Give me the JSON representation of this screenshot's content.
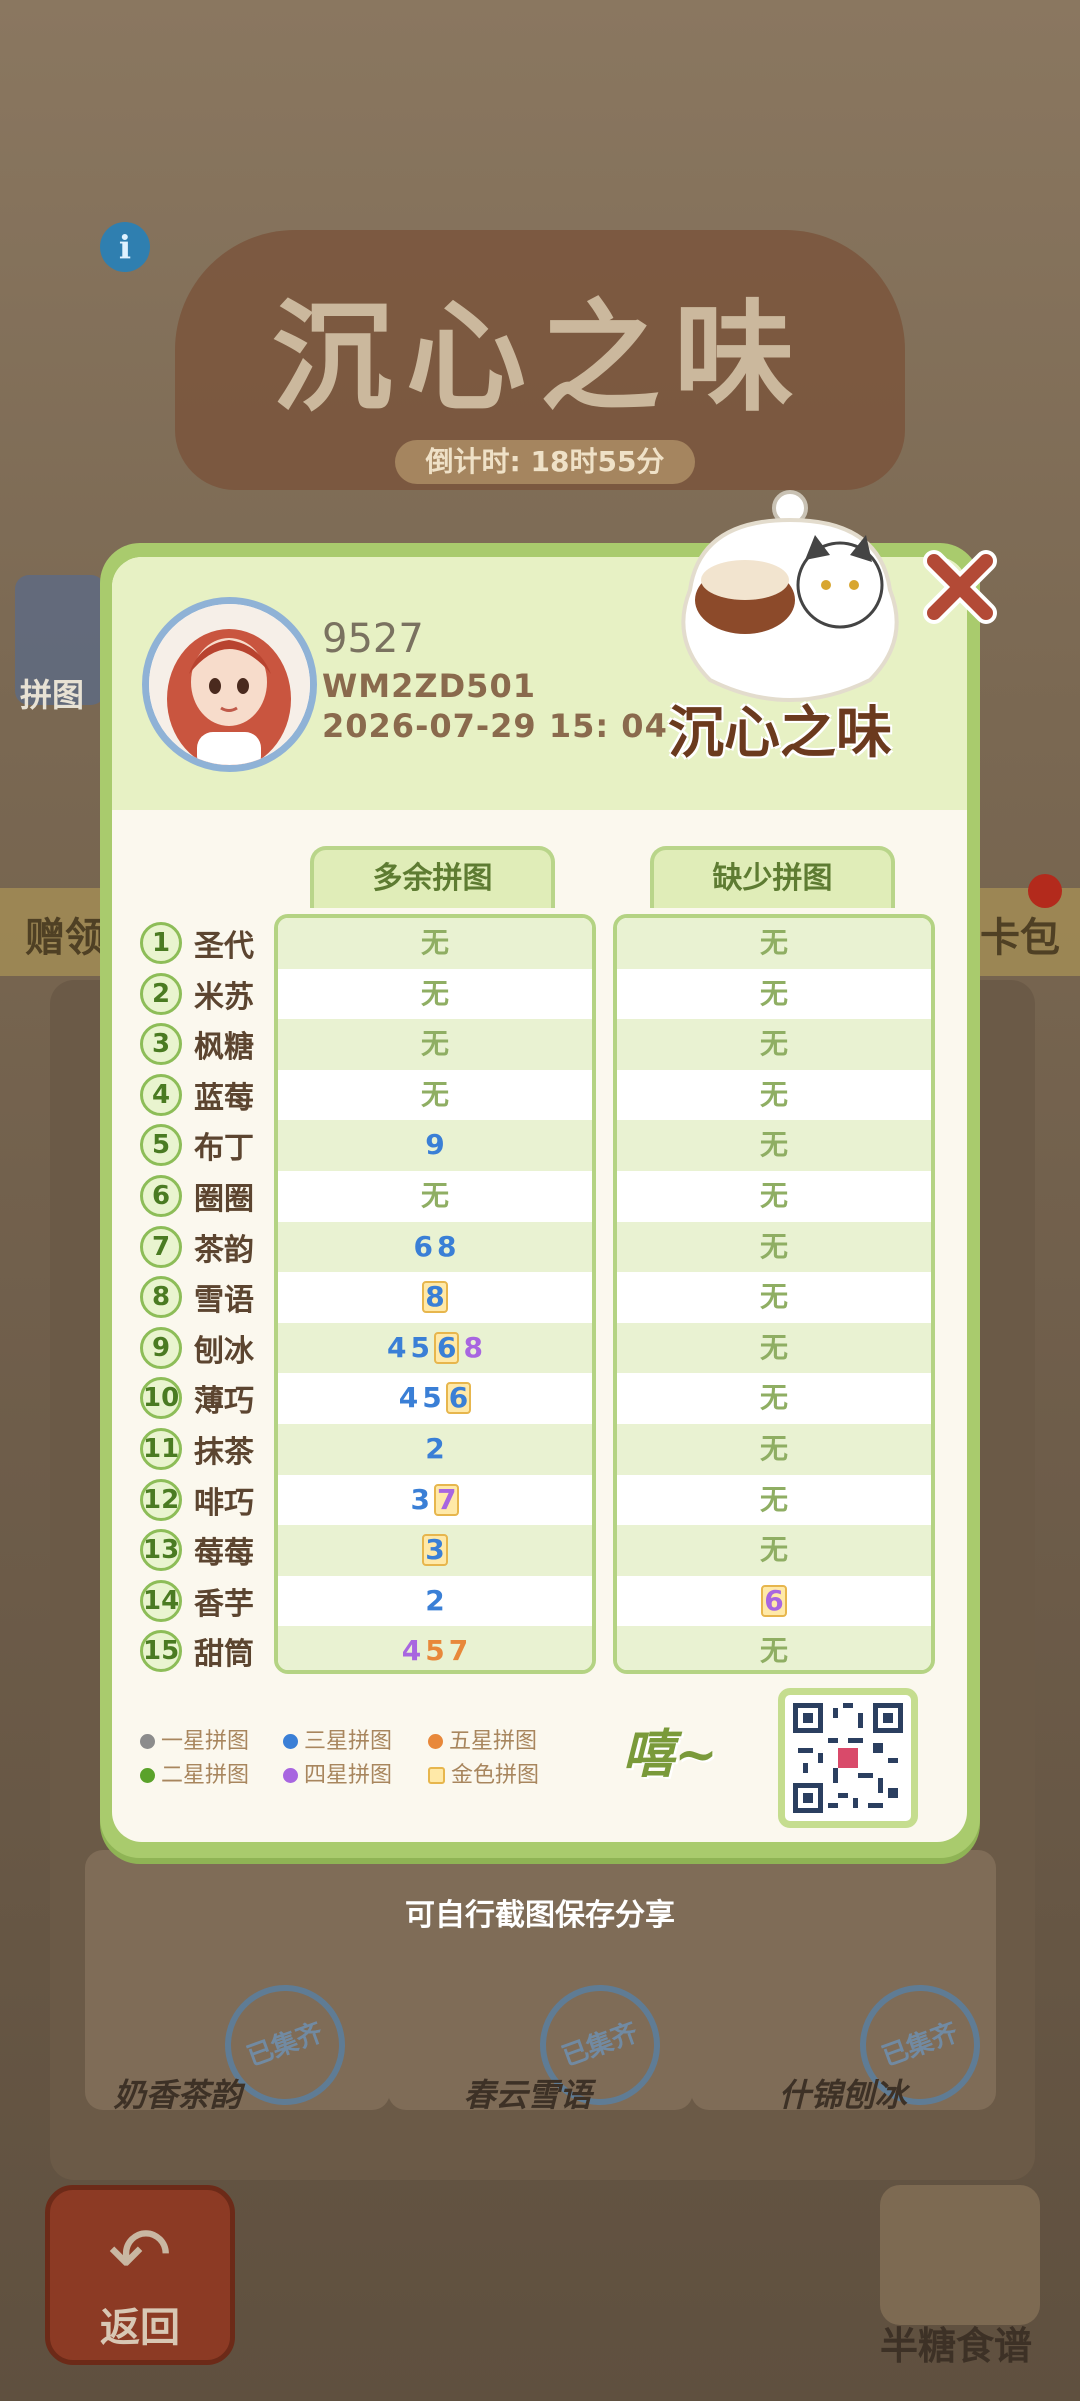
{
  "background": {
    "title": "沉心之味",
    "countdown": "倒计时: 18时55分",
    "side_left_label": "拼图",
    "shelf_left": "赠领",
    "shelf_right": "卡包",
    "cards": [
      {
        "label": "奶香茶韵",
        "stamp": "已集齐"
      },
      {
        "label": "春云雪语",
        "stamp": "已集齐"
      },
      {
        "label": "什锦刨冰",
        "stamp": "已集齐"
      }
    ],
    "back_label": "返回",
    "recipe_label": "半糖食谱"
  },
  "popup": {
    "user": {
      "name": "9527",
      "id": "WM2ZD501",
      "datetime": "2026-07-29 15: 04"
    },
    "logo_text": "沉心之味",
    "columns": {
      "extra": "多余拼图",
      "missing": "缺少拼图"
    },
    "rows": [
      {
        "num": "1",
        "name": "圣代"
      },
      {
        "num": "2",
        "name": "米苏"
      },
      {
        "num": "3",
        "name": "枫糖"
      },
      {
        "num": "4",
        "name": "蓝莓"
      },
      {
        "num": "5",
        "name": "布丁"
      },
      {
        "num": "6",
        "name": "圈圈"
      },
      {
        "num": "7",
        "name": "茶韵"
      },
      {
        "num": "8",
        "name": "雪语"
      },
      {
        "num": "9",
        "name": "刨冰"
      },
      {
        "num": "10",
        "name": "薄巧"
      },
      {
        "num": "11",
        "name": "抹茶"
      },
      {
        "num": "12",
        "name": "啡巧"
      },
      {
        "num": "13",
        "name": "莓莓"
      },
      {
        "num": "14",
        "name": "香芋"
      },
      {
        "num": "15",
        "name": "甜筒"
      }
    ],
    "none_text": "无",
    "extra_values": [
      {
        "digits": []
      },
      {
        "digits": []
      },
      {
        "digits": []
      },
      {
        "digits": []
      },
      {
        "digits": [
          {
            "v": "9",
            "tier": "three_star",
            "gold": false
          }
        ]
      },
      {
        "digits": []
      },
      {
        "digits": [
          {
            "v": "6",
            "tier": "three_star",
            "gold": false
          },
          {
            "v": "8",
            "tier": "three_star",
            "gold": false
          }
        ]
      },
      {
        "digits": [
          {
            "v": "8",
            "tier": "three_star",
            "gold": true
          }
        ]
      },
      {
        "digits": [
          {
            "v": "4",
            "tier": "three_star",
            "gold": false
          },
          {
            "v": "5",
            "tier": "three_star",
            "gold": false
          },
          {
            "v": "6",
            "tier": "three_star",
            "gold": true
          },
          {
            "v": "8",
            "tier": "four_star",
            "gold": false
          }
        ]
      },
      {
        "digits": [
          {
            "v": "4",
            "tier": "three_star",
            "gold": false
          },
          {
            "v": "5",
            "tier": "three_star",
            "gold": false
          },
          {
            "v": "6",
            "tier": "three_star",
            "gold": true
          }
        ]
      },
      {
        "digits": [
          {
            "v": "2",
            "tier": "three_star",
            "gold": false
          }
        ]
      },
      {
        "digits": [
          {
            "v": "3",
            "tier": "three_star",
            "gold": false
          },
          {
            "v": "7",
            "tier": "four_star",
            "gold": true
          }
        ]
      },
      {
        "digits": [
          {
            "v": "3",
            "tier": "three_star",
            "gold": true
          }
        ]
      },
      {
        "digits": [
          {
            "v": "2",
            "tier": "three_star",
            "gold": false
          }
        ]
      },
      {
        "digits": [
          {
            "v": "4",
            "tier": "four_star",
            "gold": false
          },
          {
            "v": "5",
            "tier": "five_star",
            "gold": false
          },
          {
            "v": "7",
            "tier": "five_star",
            "gold": false
          }
        ]
      }
    ],
    "missing_values": [
      {
        "digits": []
      },
      {
        "digits": []
      },
      {
        "digits": []
      },
      {
        "digits": []
      },
      {
        "digits": []
      },
      {
        "digits": []
      },
      {
        "digits": []
      },
      {
        "digits": []
      },
      {
        "digits": []
      },
      {
        "digits": []
      },
      {
        "digits": []
      },
      {
        "digits": []
      },
      {
        "digits": []
      },
      {
        "digits": [
          {
            "v": "6",
            "tier": "four_star",
            "gold": true
          }
        ]
      },
      {
        "digits": []
      }
    ],
    "legend": {
      "one_star": "一星拼图",
      "two_star": "二星拼图",
      "three_star": "三星拼图",
      "four_star": "四星拼图",
      "five_star": "五星拼图",
      "gold": "金色拼图"
    },
    "legend_colors": {
      "one_star": "#8c8c8c",
      "two_star": "#5aa22a",
      "three_star": "#3a7fd6",
      "four_star": "#a866e0",
      "five_star": "#e8883a",
      "gold": "#ffe9a8"
    },
    "brand_badge": "嘻~"
  },
  "save_hint": "可自行截图保存分享"
}
